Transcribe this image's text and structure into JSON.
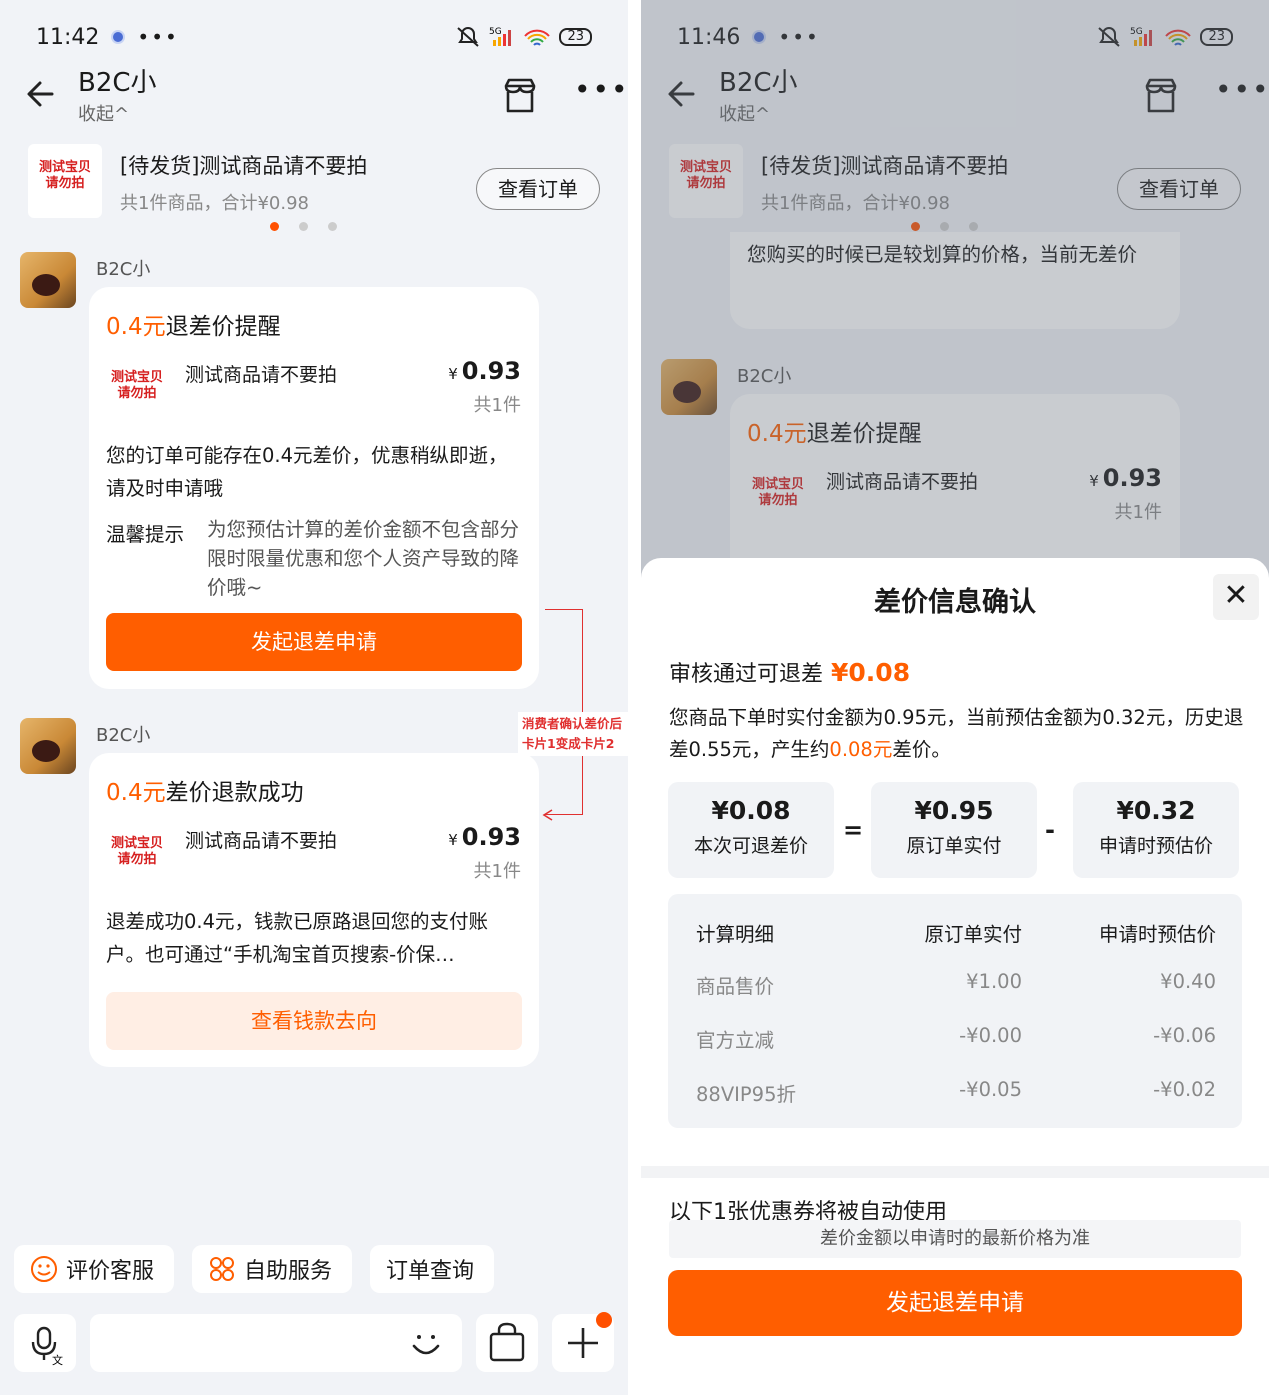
{
  "left": {
    "status": {
      "time": "11:42",
      "battery": "23"
    },
    "nav": {
      "title": "B2C小",
      "collapse": "收起^"
    },
    "order": {
      "thumb": "测试宝贝\n请勿拍",
      "title": "[待发货]测试商品请不要拍",
      "sub": "共1件商品，合计¥0.98",
      "button": "查看订单"
    },
    "sender": "B2C小",
    "card1": {
      "amount": "0.4元",
      "title_rest": "退差价提醒",
      "product_thumb": "测试宝贝\n请勿拍",
      "product": "测试商品请不要拍",
      "price_symbol": "¥",
      "price": "0.93",
      "count": "共1件",
      "body": "您的订单可能存在0.4元差价，优惠稍纵即逝，请及时申请哦",
      "tip_label": "温馨提示",
      "tip": "为您预估计算的差价金额不包含部分限时限量优惠和您个人资产导致的降价哦~",
      "button": "发起退差申请"
    },
    "card2": {
      "amount": "0.4元",
      "title_rest": "差价退款成功",
      "product_thumb": "测试宝贝\n请勿拍",
      "product": "测试商品请不要拍",
      "price_symbol": "¥",
      "price": "0.93",
      "count": "共1件",
      "body": "退差成功0.4元，钱款已原路退回您的支付账户。也可通过“手机淘宝首页搜索-价保…",
      "button": "查看钱款去向"
    },
    "annotation": "消费者确认差价后卡片1变成卡片2",
    "quick": [
      "评价客服",
      "自助服务",
      "订单查询"
    ]
  },
  "right": {
    "status": {
      "time": "11:46",
      "battery": "23"
    },
    "nav": {
      "title": "B2C小",
      "collapse": "收起^"
    },
    "order": {
      "thumb": "测试宝贝\n请勿拍",
      "title": "[待发货]测试商品请不要拍",
      "sub": "共1件商品，合计¥0.98",
      "button": "查看订单"
    },
    "prev_msg": "您购买的时候已是较划算的价格，当前无差价",
    "sender": "B2C小",
    "card": {
      "amount": "0.4元",
      "title_rest": "退差价提醒",
      "product_thumb": "测试宝贝\n请勿拍",
      "product": "测试商品请不要拍",
      "price_symbol": "¥",
      "price": "0.93",
      "count": "共1件"
    },
    "sheet": {
      "title": "差价信息确认",
      "close": "✕",
      "head": "审核通过可退差",
      "head_amount": "¥0.08",
      "desc_1": "您商品下单时实付金额为0.95元，当前预估金额为0.32元，历史退差0.55元，产生约",
      "desc_amount": "0.08元",
      "desc_2": "差价。",
      "boxes": [
        {
          "value": "¥0.08",
          "label": "本次可退差价"
        },
        {
          "value": "¥0.95",
          "label": "原订单实付"
        },
        {
          "value": "¥0.32",
          "label": "申请时预估价"
        }
      ],
      "op_eq": "=",
      "op_minus": "-",
      "table": {
        "header": [
          "计算明细",
          "原订单实付",
          "申请时预估价"
        ],
        "rows": [
          [
            "商品售价",
            "¥1.00",
            "¥0.40"
          ],
          [
            "官方立减",
            "-¥0.00",
            "-¥0.06"
          ],
          [
            "88VIP95折",
            "-¥0.05",
            "-¥0.02"
          ]
        ]
      },
      "coupon_title": "以下1张优惠券将被自动使用",
      "hint": "差价金额以申请时的最新价格为准",
      "button": "发起退差申请"
    }
  }
}
